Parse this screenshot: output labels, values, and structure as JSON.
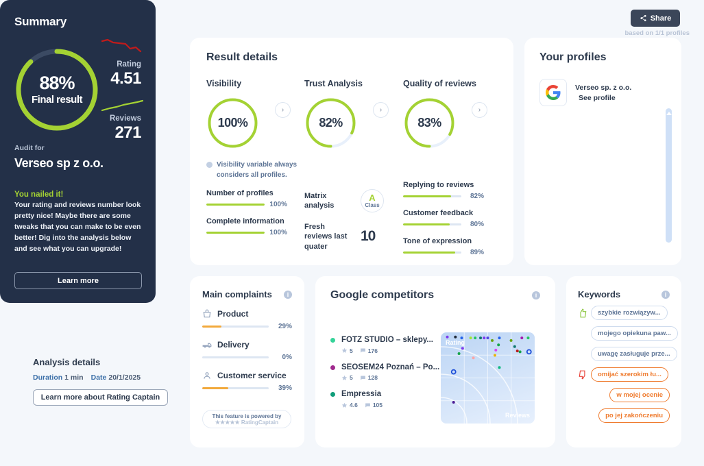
{
  "topbar": {
    "share_label": "Share"
  },
  "summary": {
    "title": "Summary",
    "based_on": "based on 1/1 profiles",
    "final_percent": "88%",
    "final_label": "Final result",
    "final_value": 88,
    "rating_label": "Rating",
    "rating_value": "4.51",
    "reviews_label": "Reviews",
    "reviews_value": "271",
    "audit_for_label": "Audit for",
    "audit_for_name": "Verseo sp z o.o.",
    "nailed_title": "You nailed it!",
    "nailed_body": "Your rating and reviews number look pretty nice! Maybe there are some tweaks that you can make to be even better! Dig into the analysis below and see what you can upgrade!",
    "learn_more": "Learn more"
  },
  "analysis": {
    "title": "Analysis details",
    "duration_key": "Duration",
    "duration_value": "1 min",
    "date_key": "Date",
    "date_value": "20/1/2025",
    "button": "Learn more about Rating Captain"
  },
  "results": {
    "title": "Result details",
    "visibility": {
      "title": "Visibility",
      "percent": "100%",
      "value": 100,
      "note": "Visibility variable always considers all profiles.",
      "metrics": [
        {
          "label": "Number of profiles",
          "percent": "100%",
          "value": 100
        },
        {
          "label": "Complete information",
          "percent": "100%",
          "value": 100
        }
      ]
    },
    "trust": {
      "title": "Trust Analysis",
      "percent": "82%",
      "value": 82,
      "matrix_label": "Matrix analysis",
      "matrix_grade": "A",
      "matrix_grade_sub": "Class",
      "fresh_label": "Fresh reviews last quater",
      "fresh_value": "10"
    },
    "quality": {
      "title": "Quality of reviews",
      "percent": "83%",
      "value": 83,
      "metrics": [
        {
          "label": "Replying to reviews",
          "percent": "82%",
          "value": 82
        },
        {
          "label": "Customer feedback",
          "percent": "80%",
          "value": 80
        },
        {
          "label": "Tone of expression",
          "percent": "89%",
          "value": 89
        }
      ]
    }
  },
  "profiles": {
    "title": "Your profiles",
    "items": [
      {
        "icon": "google-icon",
        "name": "Verseo sp. z o.o.",
        "link": "See profile"
      }
    ]
  },
  "complaints": {
    "title": "Main complaints",
    "items": [
      {
        "icon": "basket-icon",
        "label": "Product",
        "percent": "29%",
        "value": 29
      },
      {
        "icon": "truck-icon",
        "label": "Delivery",
        "percent": "0%",
        "value": 0
      },
      {
        "icon": "person-icon",
        "label": "Customer service",
        "percent": "39%",
        "value": 39
      }
    ],
    "powered_line1": "This feature is powered by",
    "powered_line2": "★★★★★ RatingCaptain"
  },
  "competitors": {
    "title": "Google competitors",
    "items": [
      {
        "color": "#35d399",
        "name": "FOTZ STUDIO – sklepy...",
        "rating": "5",
        "reviews": "176"
      },
      {
        "color": "#a02a8e",
        "name": "SEOSEM24 Poznań – Po...",
        "rating": "5",
        "reviews": "128"
      },
      {
        "color": "#0f9d7a",
        "name": "Empressia",
        "rating": "4.6",
        "reviews": "105"
      }
    ],
    "chart_axis_y": "Rating",
    "chart_axis_x": "Reviews"
  },
  "keywords": {
    "title": "Keywords",
    "items": [
      {
        "label": "szybkie rozwiązyw...",
        "sentiment": "positive",
        "icon": "thumbs-up-icon",
        "align": "left"
      },
      {
        "label": "mojego opiekuna paw...",
        "sentiment": "neutral",
        "icon": "",
        "align": "left"
      },
      {
        "label": "uwagę zasługuje prze...",
        "sentiment": "neutral",
        "icon": "",
        "align": "left"
      },
      {
        "label": "omijać szerokim łu...",
        "sentiment": "negative",
        "icon": "thumbs-down-icon",
        "align": "left"
      },
      {
        "label": "w mojej ocenie",
        "sentiment": "negative",
        "icon": "",
        "align": "right"
      },
      {
        "label": "po jej zakończeniu",
        "sentiment": "negative",
        "icon": "",
        "align": "right"
      }
    ]
  },
  "chart_data": [
    {
      "type": "line",
      "title": "Rating trend",
      "x": [
        0,
        1,
        2,
        3,
        4,
        5,
        6,
        7
      ],
      "values": [
        4.8,
        4.78,
        4.7,
        4.68,
        4.66,
        4.5,
        4.45,
        4.3
      ],
      "color": "#c01b1b",
      "ylabel": "Rating"
    },
    {
      "type": "line",
      "title": "Reviews trend",
      "x": [
        0,
        1,
        2,
        3,
        4,
        5,
        6,
        7
      ],
      "values": [
        180,
        195,
        205,
        222,
        235,
        248,
        260,
        271
      ],
      "color": "#a4d233",
      "ylabel": "Reviews"
    },
    {
      "type": "scatter",
      "title": "Google competitors positioning",
      "xlabel": "Reviews",
      "ylabel": "Rating",
      "xlim": [
        0,
        100
      ],
      "ylim": [
        0,
        100
      ],
      "grid": true,
      "points": [
        {
          "x": 5,
          "y": 97,
          "color": "#7c3aed"
        },
        {
          "x": 14,
          "y": 97,
          "color": "#1f2937"
        },
        {
          "x": 21,
          "y": 96,
          "color": "#2563eb"
        },
        {
          "x": 31,
          "y": 96,
          "color": "#a3e635"
        },
        {
          "x": 36,
          "y": 96,
          "color": "#22c55e"
        },
        {
          "x": 42,
          "y": 96,
          "color": "#0f766e"
        },
        {
          "x": 46,
          "y": 96,
          "color": "#7c3aed"
        },
        {
          "x": 50,
          "y": 96,
          "color": "#4f46e5"
        },
        {
          "x": 55,
          "y": 93,
          "color": "#65a30d"
        },
        {
          "x": 63,
          "y": 96,
          "color": "#2563eb"
        },
        {
          "x": 62,
          "y": 88,
          "color": "#16a34a"
        },
        {
          "x": 59,
          "y": 82,
          "color": "#d946ef"
        },
        {
          "x": 58,
          "y": 76,
          "color": "#eab308"
        },
        {
          "x": 76,
          "y": 93,
          "color": "#65a30d"
        },
        {
          "x": 88,
          "y": 96,
          "color": "#a21caf"
        },
        {
          "x": 95,
          "y": 96,
          "color": "#22c55e"
        },
        {
          "x": 80,
          "y": 86,
          "color": "#0f766e"
        },
        {
          "x": 83,
          "y": 81,
          "color": "#b91c1c"
        },
        {
          "x": 86,
          "y": 80,
          "color": "#16a34a"
        },
        {
          "x": 22,
          "y": 84,
          "color": "#7c3aed"
        },
        {
          "x": 18,
          "y": 78,
          "color": "#16a34a"
        },
        {
          "x": 34,
          "y": 73,
          "color": "#fca5a5"
        },
        {
          "x": 63,
          "y": 62,
          "color": "#10b981"
        },
        {
          "x": 96,
          "y": 80,
          "color": "#1d4ed8",
          "hollow": true
        },
        {
          "x": 12,
          "y": 57,
          "color": "#1d4ed8",
          "hollow": true
        },
        {
          "x": 12,
          "y": 22,
          "color": "#4c1d95"
        }
      ]
    }
  ]
}
